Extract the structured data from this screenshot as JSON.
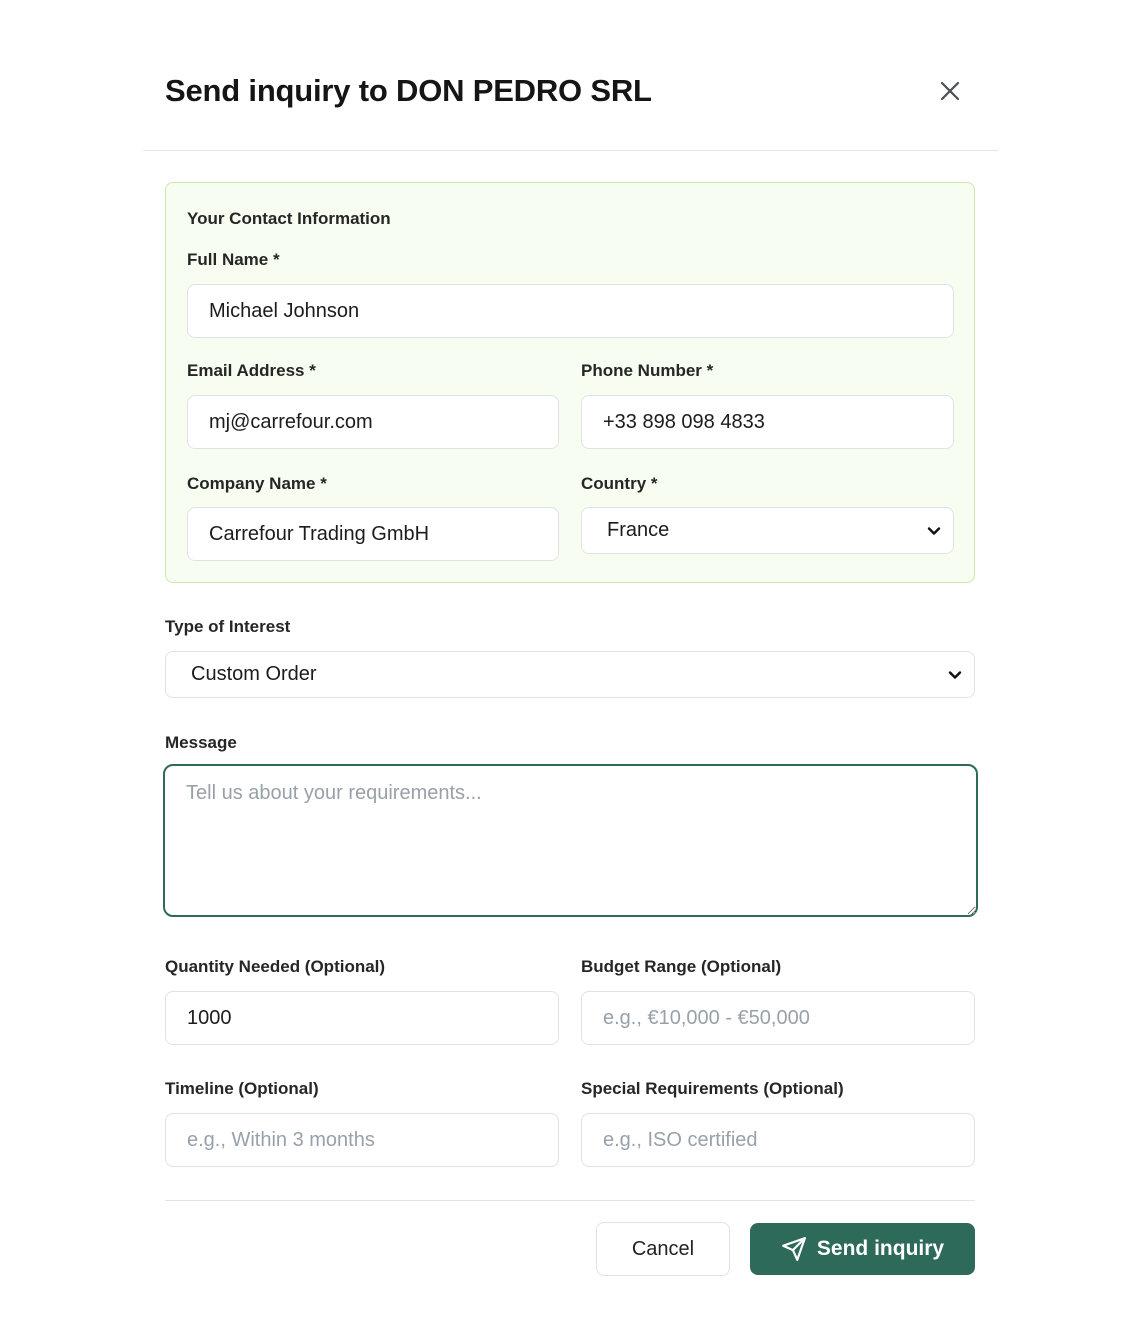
{
  "dialog": {
    "title": "Send inquiry to DON PEDRO SRL",
    "close_icon": "close-icon"
  },
  "contact": {
    "section_title": "Your Contact Information",
    "full_name": {
      "label": "Full Name *",
      "value": "Michael Johnson"
    },
    "email": {
      "label": "Email Address *",
      "value": "mj@carrefour.com"
    },
    "phone": {
      "label": "Phone Number *",
      "value": "+33 898 098 4833"
    },
    "company": {
      "label": "Company Name *",
      "value": "Carrefour Trading GmbH"
    },
    "country": {
      "label": "Country *",
      "value": "France"
    }
  },
  "interest": {
    "label": "Type of Interest",
    "value": "Custom Order"
  },
  "message": {
    "label": "Message",
    "value": "",
    "placeholder": "Tell us about your requirements..."
  },
  "quantity": {
    "label": "Quantity Needed (Optional)",
    "value": "1000",
    "placeholder": ""
  },
  "budget": {
    "label": "Budget Range (Optional)",
    "value": "",
    "placeholder": "e.g., €10,000 - €50,000"
  },
  "timeline": {
    "label": "Timeline (Optional)",
    "value": "",
    "placeholder": "e.g., Within 3 months"
  },
  "special": {
    "label": "Special Requirements (Optional)",
    "value": "",
    "placeholder": "e.g., ISO certified"
  },
  "actions": {
    "cancel_label": "Cancel",
    "send_label": "Send inquiry",
    "send_icon": "send-icon"
  },
  "colors": {
    "primary": "#2d6a5a",
    "contact_bg": "#f7fdf0",
    "contact_border": "#c9eba7"
  }
}
